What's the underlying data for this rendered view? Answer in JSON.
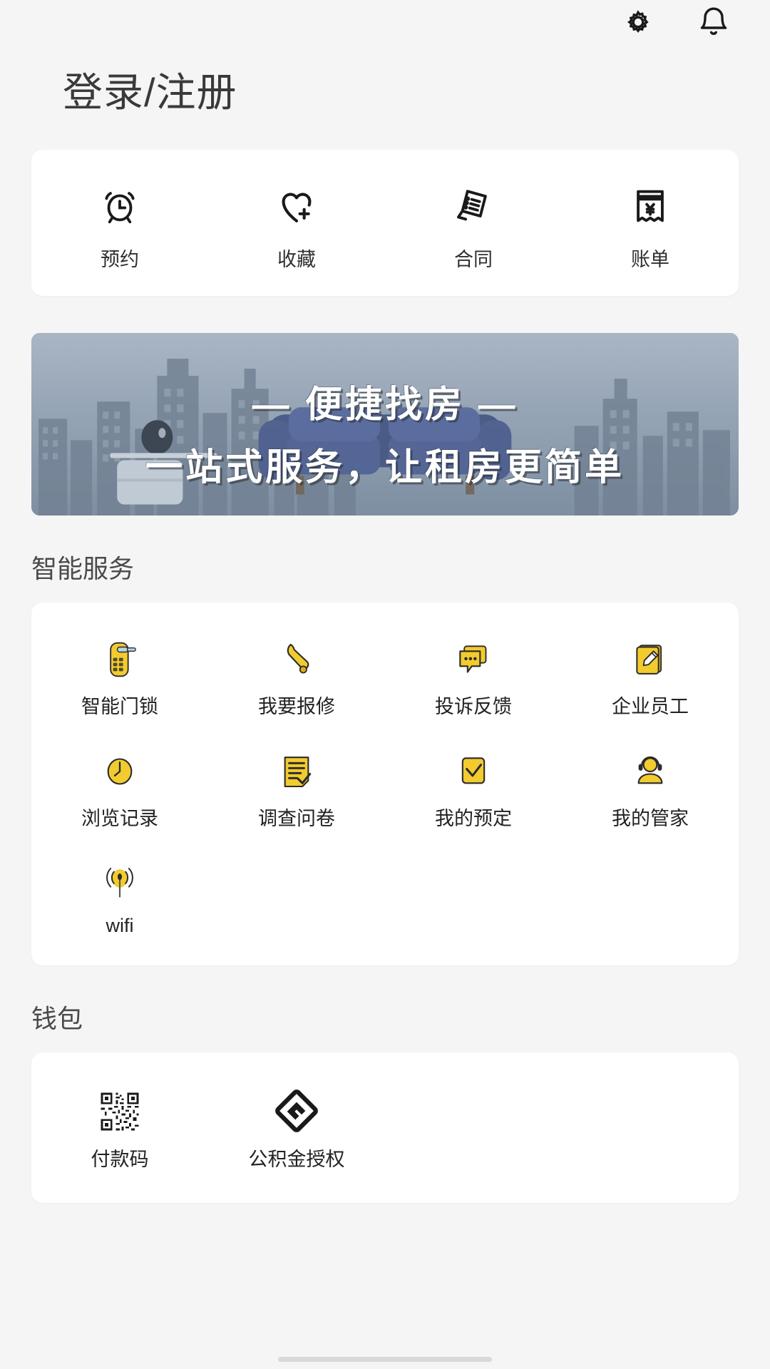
{
  "theme": {
    "page_bg": "#f5f5f5",
    "card_bg": "#ffffff",
    "accent_yellow": "#f2cb2e",
    "text_dark": "#2f2f2f",
    "title_color": "#3a3a3a",
    "banner_blue": "#8b9bad"
  },
  "topbar": {
    "settings_icon": "gear-icon",
    "notification_icon": "bell-icon"
  },
  "header": {
    "title": "登录/注册"
  },
  "quick_actions": {
    "items": [
      {
        "label": "预约",
        "icon": "alarm-clock-icon"
      },
      {
        "label": "收藏",
        "icon": "heart-plus-icon"
      },
      {
        "label": "合同",
        "icon": "contract-document-icon"
      },
      {
        "label": "账单",
        "icon": "receipt-yuan-icon"
      }
    ]
  },
  "banner": {
    "line1": "— 便捷找房 —",
    "line2": "一站式服务，让租房更简单"
  },
  "smart_services": {
    "heading": "智能服务",
    "items": [
      {
        "label": "智能门锁",
        "icon": "smart-door-lock-icon"
      },
      {
        "label": "我要报修",
        "icon": "wrench-repair-icon"
      },
      {
        "label": "投诉反馈",
        "icon": "speech-bubble-icon"
      },
      {
        "label": "企业员工",
        "icon": "notebook-pencil-icon"
      },
      {
        "label": "浏览记录",
        "icon": "clock-history-icon"
      },
      {
        "label": "调查问卷",
        "icon": "survey-checklist-icon"
      },
      {
        "label": "我的预定",
        "icon": "checkmark-square-icon"
      },
      {
        "label": "我的管家",
        "icon": "headset-person-icon"
      },
      {
        "label": "wifi",
        "icon": "wifi-broadcast-icon"
      }
    ]
  },
  "wallet": {
    "heading": "钱包",
    "items": [
      {
        "label": "付款码",
        "icon": "qr-code-icon"
      },
      {
        "label": "公积金授权",
        "icon": "housing-fund-diamond-icon"
      }
    ]
  }
}
